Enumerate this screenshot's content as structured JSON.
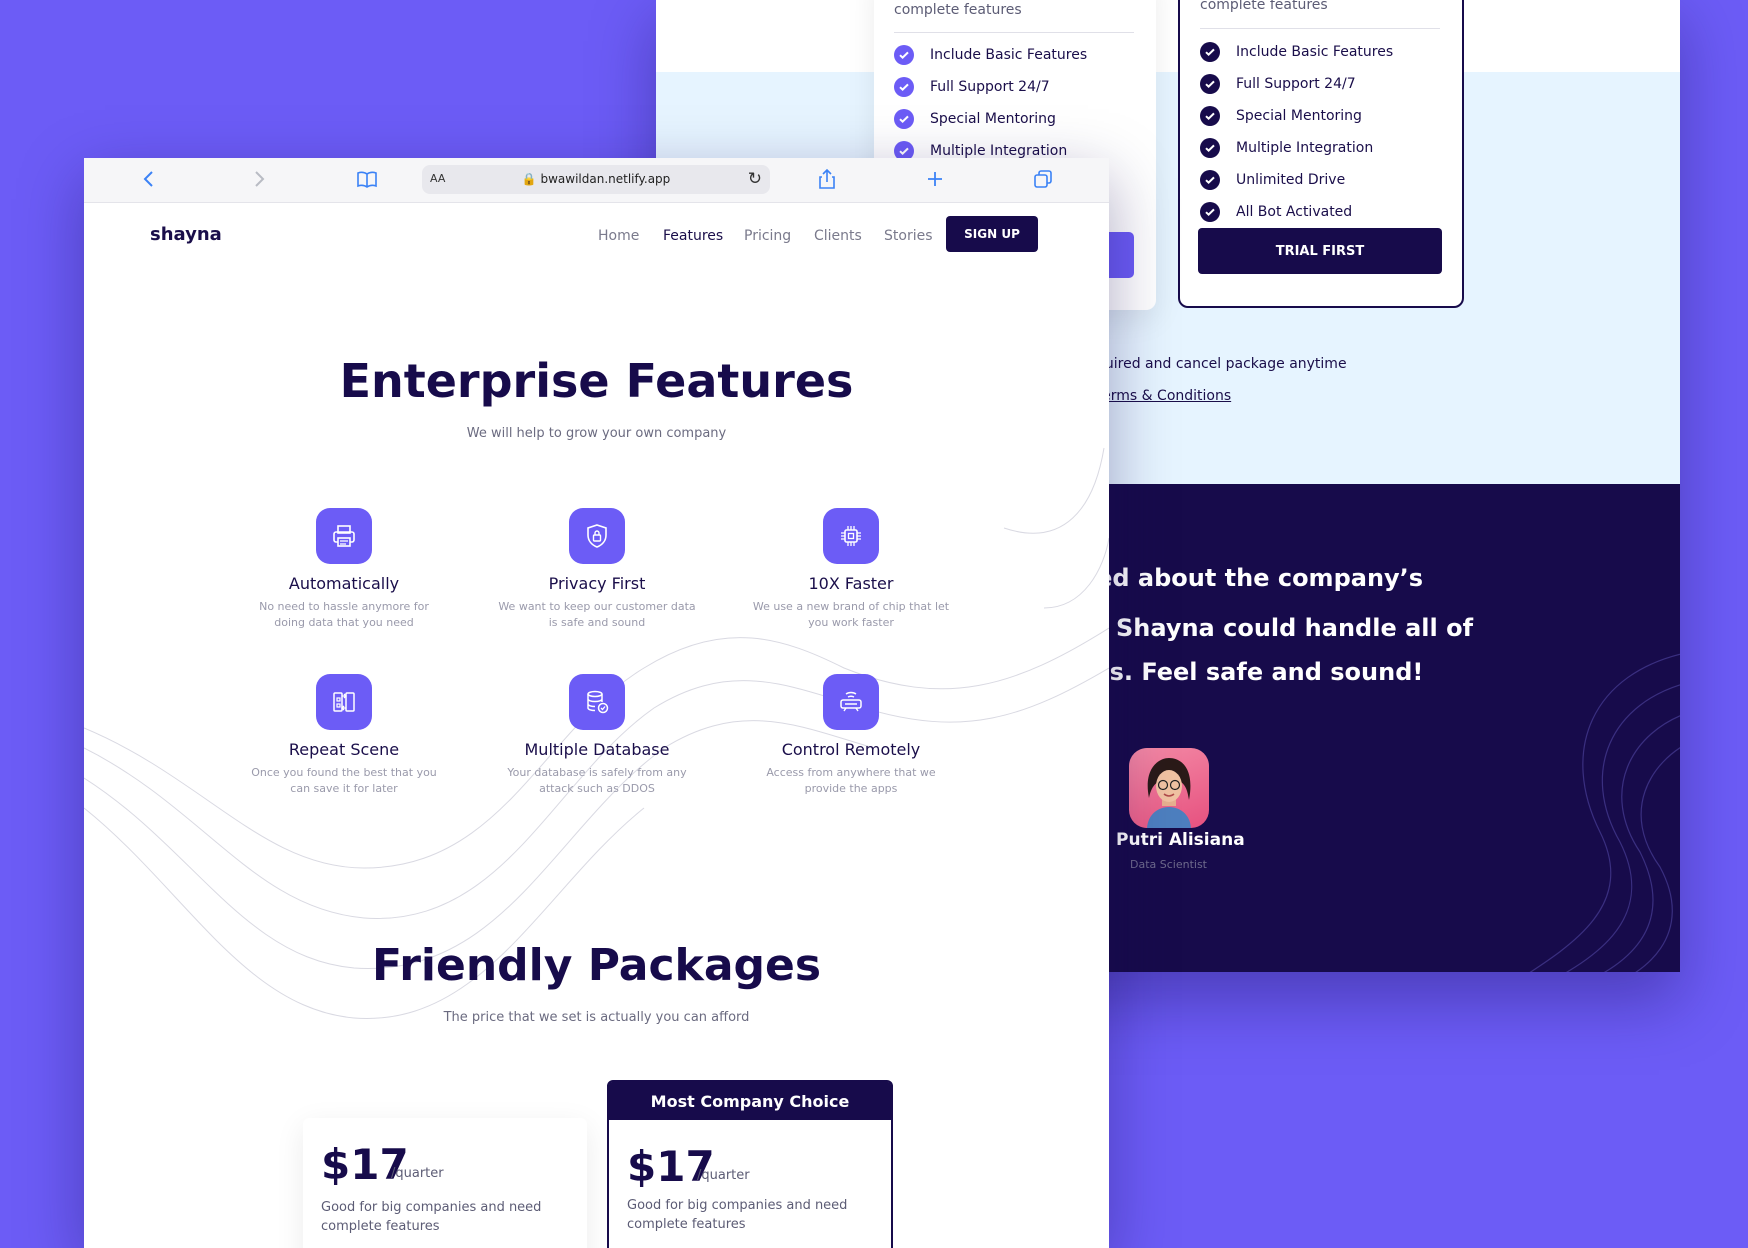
{
  "back": {
    "card_left": {
      "desc": "Good for big companies and need complete features",
      "features": [
        "Include Basic Features",
        "Full Support 24/7",
        "Special Mentoring",
        "Multiple Integration"
      ]
    },
    "card_right": {
      "desc": "complete features",
      "features": [
        "Include Basic Features",
        "Full Support 24/7",
        "Special Mentoring",
        "Multiple Integration",
        "Unlimited Drive",
        "All Bot Activated"
      ],
      "button": "TRIAL FIRST"
    },
    "note": "quired and cancel package anytime",
    "terms_link": "Terms & Conditions",
    "quote_lines": [
      "ried about the company’s",
      "Shayna could handle all of",
      "ons. Feel safe and sound!"
    ],
    "person": {
      "name": "ayu Putri Alisiana",
      "role": "Data Scientist"
    }
  },
  "browser": {
    "url": "bwawildan.netlify.app",
    "aa_label": "AA"
  },
  "nav": {
    "logo": "shayna",
    "links": [
      "Home",
      "Features",
      "Pricing",
      "Clients",
      "Stories"
    ],
    "active": "Features",
    "signup": "SIGN UP"
  },
  "features_section": {
    "title": "Enterprise Features",
    "subtitle": "We will help to grow your own company",
    "items": [
      {
        "icon": "printer-icon",
        "title": "Automatically",
        "desc": "No need to hassle anymore for doing data that you need"
      },
      {
        "icon": "shield-lock-icon",
        "title": "Privacy First",
        "desc": "We want to keep our customer data is safe and sound"
      },
      {
        "icon": "chip-icon",
        "title": "10X Faster",
        "desc": "We use a new brand of chip that let you work faster"
      },
      {
        "icon": "repeat-icon",
        "title": "Repeat Scene",
        "desc": "Once you found the best that you can save it for later"
      },
      {
        "icon": "database-icon",
        "title": "Multiple Database",
        "desc": "Your database is safely from any attack such as DDOS"
      },
      {
        "icon": "remote-icon",
        "title": "Control Remotely",
        "desc": "Access from anywhere that we provide the apps"
      }
    ]
  },
  "packages": {
    "title": "Friendly Packages",
    "subtitle": "The price that we set is actually you can afford",
    "cards": [
      {
        "price": "$17",
        "period": "/quarter",
        "desc": "Good for big companies and need complete features"
      },
      {
        "badge": "Most Company Choice",
        "price": "$17",
        "period": "/quarter",
        "desc": "Good for big companies and need complete features"
      }
    ]
  },
  "colors": {
    "accent": "#6c5cf6",
    "dark": "#170b4b",
    "light_bg": "#e6f4ff"
  }
}
